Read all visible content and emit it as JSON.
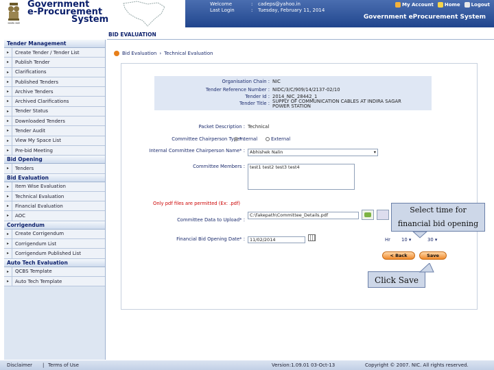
{
  "brand": {
    "line1": "Government",
    "line2": "e-Procurement",
    "line3": "System",
    "emblem_caption": "सत्यमेव जयते"
  },
  "topbar": {
    "welcome_label": "Welcome",
    "welcome_value": "cadeps@yahoo.in",
    "lastlogin_label": "Last Login",
    "lastlogin_value": "Tuesday, February 11, 2014",
    "my_account": "My Account",
    "home": "Home",
    "logout": "Logout",
    "system_title": "Government eProcurement System"
  },
  "sidebar": {
    "sections": [
      {
        "title": "Tender Management",
        "items": [
          "Create Tender / Tender List",
          "Publish Tender",
          "Clarifications",
          "Published Tenders",
          "Archive Tenders",
          "Archived Clarifications",
          "Tender Status",
          "Downloaded Tenders",
          "Tender Audit",
          "View My Space List",
          "Pre-bid Meeting"
        ]
      },
      {
        "title": "Bid Opening",
        "items": [
          "Tenders"
        ]
      },
      {
        "title": "Bid Evaluation",
        "items": [
          "Item Wise Evaluation",
          "Technical Evaluation",
          "Financial Evaluation",
          "AOC"
        ]
      },
      {
        "title": "Corrigendum",
        "items": [
          "Create Corrigendum",
          "Corrigendum List",
          "Corrigendum Published List"
        ]
      },
      {
        "title": "Auto Tech Evaluation",
        "items": [
          "QCBS Template",
          "Auto Tech Template"
        ]
      }
    ]
  },
  "main": {
    "heading": "BID EVALUATION",
    "crumb1": "Bid Evaluation",
    "crumb2": "Technical Evaluation",
    "info": {
      "org_label": "Organisation Chain :",
      "org_value": "NIC",
      "ref_label": "Tender Reference Number :",
      "ref_value": "NIDC/3/C/909/14/2137-02/10",
      "id_label": "Tender Id :",
      "id_value": "2014_NIC_28442_1",
      "title_label": "Tender Title :",
      "title_value": "SUPPLY OF COMMUNICATION CABLES AT INDIRA SAGAR POWER STATION"
    },
    "packet_label": "Packet Description :",
    "packet_value": "Technical",
    "chair_type_label": "Committee Chairperson Type* :",
    "chair_internal": "Internal",
    "chair_external": "External",
    "chair_name_label": "Internal Committee Chairperson Name* :",
    "chair_name_value": "Abhishek Nalin",
    "members_label": "Committee Members :",
    "members_value": "test1 test2 test3 test4",
    "pdf_note": "Only pdf files are permitted (Ex: .pdf)",
    "upload_label": "Committee Data to Upload* :",
    "upload_value": "C:\\fakepath\\Committee_Details.pdf",
    "fin_label": "Financial Bid Opening Date* :",
    "fin_date": "11/02/2014",
    "hour_label": "Hr",
    "hour_value": "10",
    "min_value": "30",
    "back_btn": "< Back",
    "save_btn": "Save"
  },
  "callouts": {
    "time": "Select time for financial bid opening",
    "save": "Click Save"
  },
  "footer": {
    "disclaimer": "Disclaimer",
    "terms": "Terms of Use",
    "version": "Version:1.09.01 03-Oct-13",
    "copyright": "Copyright © 2007. NIC. All rights reserved."
  }
}
